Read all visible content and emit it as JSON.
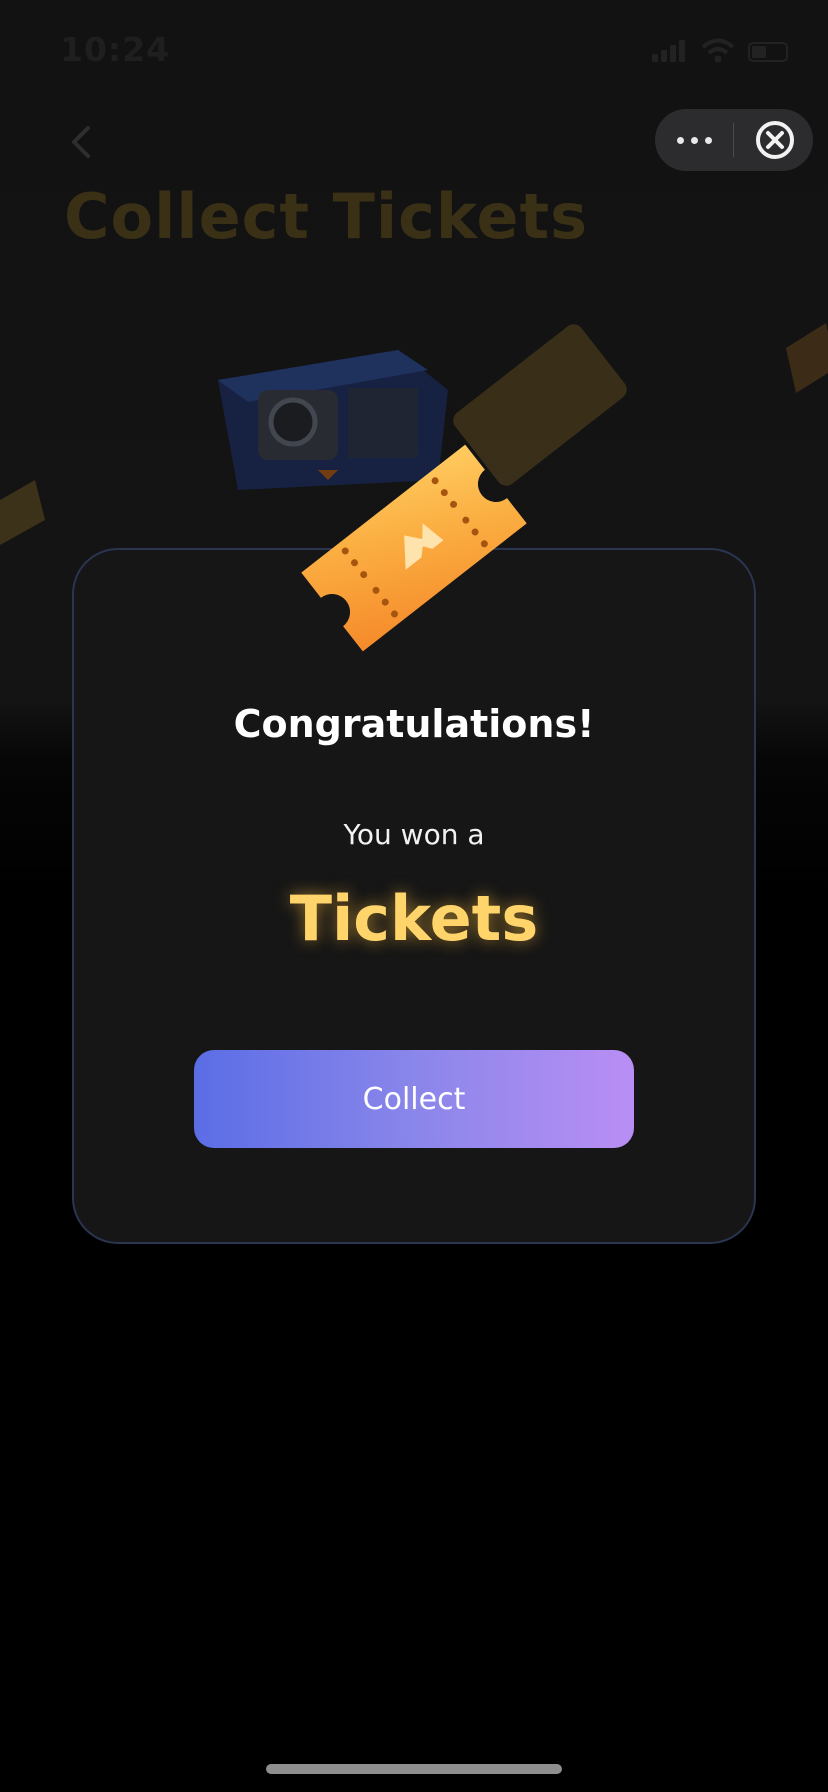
{
  "status_bar": {
    "time": "10:24"
  },
  "header": {
    "title": "Collect Tickets",
    "back_icon": "chevron-left-icon",
    "more_icon": "more-dots-icon",
    "close_icon": "close-circle-icon"
  },
  "modal": {
    "title": "Congratulations!",
    "subtitle": "You won a",
    "prize": "Tickets",
    "button_label": "Collect",
    "hero_icon": "ticket-icon"
  },
  "colors": {
    "background": "#000000",
    "modal_bg": "#161616",
    "modal_border": "#2a3550",
    "prize_gold": "#ffd46b",
    "button_gradient_start": "#5b6de6",
    "button_gradient_end": "#b98ef4",
    "ticket_orange": "#f8a23a"
  }
}
